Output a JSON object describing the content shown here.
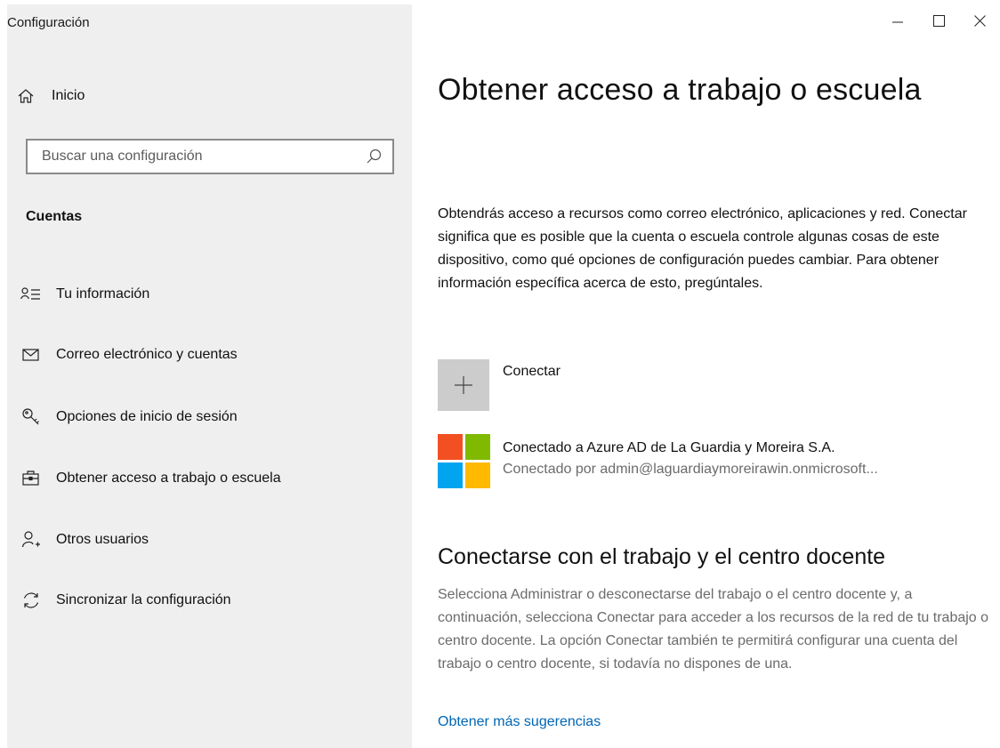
{
  "window": {
    "title": "Configuración",
    "controls": [
      "minimize",
      "maximize",
      "close"
    ]
  },
  "sidebar": {
    "home_label": "Inicio",
    "search": {
      "placeholder": "Buscar una configuración",
      "value": ""
    },
    "section_heading": "Cuentas",
    "items": [
      {
        "label": "Tu información",
        "icon": "user-info-icon"
      },
      {
        "label": "Correo electrónico y cuentas",
        "icon": "mail-icon"
      },
      {
        "label": "Opciones de inicio de sesión",
        "icon": "key-icon"
      },
      {
        "label": "Obtener acceso a trabajo o escuela",
        "icon": "briefcase-icon"
      },
      {
        "label": "Otros usuarios",
        "icon": "add-user-icon"
      },
      {
        "label": "Sincronizar la configuración",
        "icon": "sync-icon"
      }
    ]
  },
  "main": {
    "title": "Obtener acceso a trabajo o escuela",
    "description": "Obtendrás acceso a recursos como correo electrónico, aplicaciones y red. Conectar significa que es posible que la cuenta o escuela controle algunas cosas de este dispositivo, como qué opciones de configuración puedes cambiar. Para obtener información específica acerca de esto, pregúntales.",
    "connect_label": "Conectar",
    "account": {
      "title": "Conectado a Azure AD de La Guardia y Moreira S.A.",
      "subtitle": "Conectado por admin@laguardiaymoreirawin.onmicrosoft..."
    },
    "help_heading": "Conectarse con el trabajo y el centro docente",
    "help_text": "Selecciona Administrar o desconectarse del trabajo o el centro docente y, a continuación, selecciona Conectar para acceder a los recursos de la red de tu trabajo o centro docente. La opción Conectar también te permitirá configurar una cuenta del trabajo o centro docente, si todavía no dispones de una.",
    "more_link": "Obtener más sugerencias"
  },
  "colors": {
    "sidebar_bg": "#efefef",
    "link": "#0066b4",
    "ms_red": "#f25022",
    "ms_green": "#7fba00",
    "ms_blue": "#00a4ef",
    "ms_yellow": "#ffb900"
  }
}
